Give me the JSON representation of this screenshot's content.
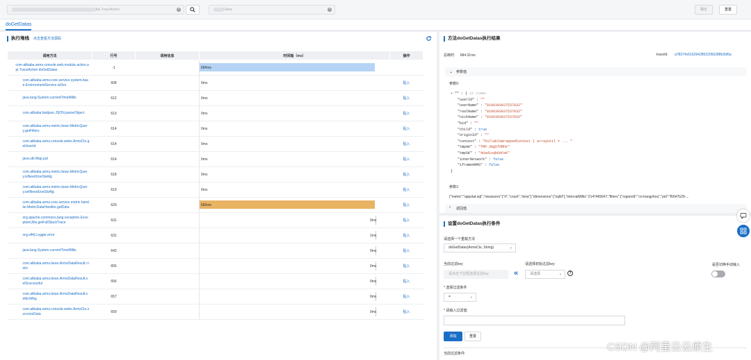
{
  "header": {
    "search_suffix": "Api.TraceAction",
    "search_icon": "search-icon",
    "method_suffix": "Datas",
    "confirm_label": "确定",
    "reset_label": "重置"
  },
  "tabs": [
    {
      "label": "doGetDatas"
    }
  ],
  "left": {
    "title": "执行堆栈",
    "link": "点击查看方法源码",
    "refresh_icon": "refresh-icon",
    "columns": [
      "调用方法",
      "行号",
      "调用信息",
      "时间轴（ms）",
      "操作"
    ],
    "rows": [
      {
        "method": "com.alibaba.arms.console.web.module.action.api.TraceAction doGetDatas",
        "line": "-1",
        "time": "684ms",
        "bar": 1.0,
        "color": "#b5d3f5",
        "op": ""
      },
      {
        "method": "com.alibaba.arms.core.service.system.base.EnvironmentService.isDev",
        "line": "608",
        "time": "0ms",
        "bar": 0,
        "op": "贴入"
      },
      {
        "method": "java.lang.System.currentTimeMillis",
        "line": "612",
        "time": "0ms",
        "bar": 0,
        "op": "贴入"
      },
      {
        "method": "com.alibaba.fastjson.JSON.parseObject",
        "line": "613",
        "time": "0ms",
        "bar": 0,
        "op": "贴入"
      },
      {
        "method": "com.alibaba.arms.metric.bean.MetricQuery.getFilters",
        "line": "614",
        "time": "0ms",
        "bar": 0,
        "op": "贴入"
      },
      {
        "method": "com.alibaba.arms.console.webx.ArmsCtx.getUserId",
        "line": "614",
        "time": "0ms",
        "bar": 0,
        "op": "贴入"
      },
      {
        "method": "java.util.Map.put",
        "line": "614",
        "time": "0ms",
        "bar": 0,
        "op": "贴入"
      },
      {
        "method": "com.alibaba.arms.metric.bean.MetricQuery.isNeedUseSlsAlg",
        "line": "618",
        "time": "0ms",
        "bar": 0,
        "op": "贴入"
      },
      {
        "method": "com.alibaba.arms.metric.bean.MetricQuery.setNeedUseSlsAlg",
        "line": "619",
        "time": "0ms",
        "bar": 0,
        "op": "贴入"
      },
      {
        "method": "com.alibaba.arms.core.service.metric.handler.MetricDataHandler.getData",
        "line": "629",
        "time": "683ms",
        "bar": 1.0,
        "color": "#e8b363",
        "op": "贴入"
      },
      {
        "method": "org.apache.commons.lang.exception.ExceptionUtils.getFullStackTrace",
        "line": "631",
        "time": "0ms",
        "bar": 0,
        "right": true,
        "op": "贴入"
      },
      {
        "method": "org.slf4j.Logger.error",
        "line": "631",
        "time": "1ms",
        "bar": 0,
        "right": true,
        "op": "贴入"
      },
      {
        "method": "java.lang.System.currentTimeMillis",
        "line": "643",
        "time": "0ms",
        "bar": 0,
        "right": true,
        "op": "贴入"
      },
      {
        "method": "com.alibaba.arms.bean.ArmsDataResult.<init>",
        "line": "655",
        "time": "0ms",
        "bar": 0,
        "right": true,
        "op": "贴入"
      },
      {
        "method": "com.alibaba.arms.bean.ArmsDataResult.setSuccessful",
        "line": "656",
        "time": "0ms",
        "bar": 0,
        "right": true,
        "op": "贴入"
      },
      {
        "method": "com.alibaba.arms.bean.ArmsDataResult.setErrMsg",
        "line": "657",
        "time": "0ms",
        "bar": 0,
        "right": true,
        "op": "贴入"
      },
      {
        "method": "com.alibaba.arms.console.webx.ArmsCtx.successData",
        "line": "659",
        "time": "0ms",
        "bar": 0,
        "right": true,
        "op": "贴入"
      }
    ]
  },
  "result": {
    "title": "方法doGetDatas执行结果",
    "total_label": "总耗时:",
    "total_value": "684.31ms",
    "traceid_label": "traceId:",
    "traceid_value": "a78374c6162942863205628862bf5a",
    "params_section": "参数值",
    "param0_label": "参数0:",
    "items_count": "12 items",
    "json_lines": [
      {
        "k": "\"\" : {",
        "v": ""
      },
      {
        "k": "\"userId\" :",
        "v": "\"\""
      },
      {
        "k": "\"userName\" :",
        "v": "\"8106393037537832\""
      },
      {
        "k": "\"realName\" :",
        "v": "\"8106393037537832\""
      },
      {
        "k": "\"nickName\" :",
        "v": "\"8106393037537832\""
      },
      {
        "k": "\"bid\" :",
        "v": "\"\""
      },
      {
        "k": "\"child\" :",
        "v": "true"
      },
      {
        "k": "\"originId\" :",
        "v": "\"\""
      },
      {
        "k": "\"context\" :",
        "v": "\"PullableWrappedContext { arrayUtil = ... \""
      },
      {
        "k": "\"tmpAK\" :",
        "v": "\"TMP.3Hg5fdMhk\""
      },
      {
        "k": "\"tmpSK\" :",
        "v": "\"4Uadixqb6AFeK\""
      },
      {
        "k": "\"innerNetwork\" :",
        "v": "false"
      },
      {
        "k": "\"iframeARMS\" :",
        "v": "false"
      },
      {
        "k": "}",
        "v": ""
      }
    ],
    "param1_label": "参数1:",
    "param1_value": "{\"metric\":\"appstat.sql\",\"measures\":[\"rt\",\"count\",\"slow\"],\"dimensions\":[\"sqlId\"],\"intervalMillis\":2147483647,\"filters\":{\"regionId\":\"cn-hangzhou\",\"pid\":\"f6647b29-...",
    "return_section": "返回值"
  },
  "condition": {
    "title": "设置doGetDatas执行条件",
    "select_method_label": "请选择一个重载方法",
    "method_value": "doGetDatas(ArmsCtx, String)",
    "filter_key_label": "当前过滤key",
    "filter_key_placeholder": "请点击下拉框选择过滤key",
    "init_key_label": "请选择初始过滤key",
    "init_key_placeholder": "请选择",
    "help_icon": "question-icon",
    "manual_label": "是否切换手动输入",
    "filter_cond_label": "* 选择过滤条件",
    "filter_cond_value": "=",
    "filter_value_label": "* 请输入过滤值:",
    "add_label": "添加",
    "reset_label": "重置",
    "current_cond_label": "当前过滤条件:"
  },
  "watermark": "CSDN @阿里云云原生"
}
